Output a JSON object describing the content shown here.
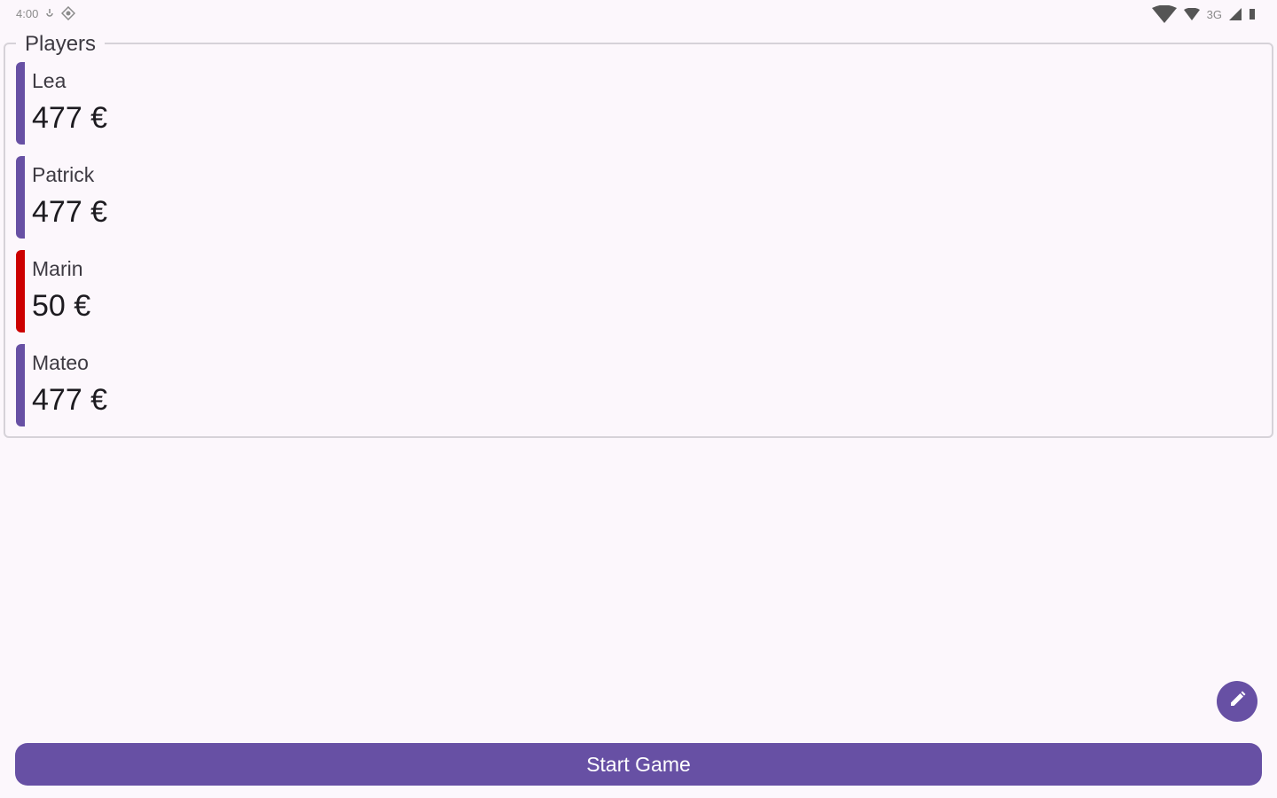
{
  "status_bar": {
    "time": "4:00",
    "network_label": "3G",
    "icons": [
      "settings-icon",
      "gear-icon",
      "wifi-icon",
      "signal-icon",
      "battery-icon"
    ]
  },
  "players_section": {
    "title": "Players",
    "players": [
      {
        "name": "Lea",
        "balance": "477 €",
        "accent_color": "#6750a4"
      },
      {
        "name": "Patrick",
        "balance": "477 €",
        "accent_color": "#6750a4"
      },
      {
        "name": "Marin",
        "balance": "50 €",
        "accent_color": "#cc0000"
      },
      {
        "name": "Mateo",
        "balance": "477 €",
        "accent_color": "#6750a4"
      }
    ]
  },
  "fab": {
    "icon": "pencil-icon"
  },
  "actions": {
    "start_label": "Start Game"
  },
  "colors": {
    "primary": "#6750a4",
    "warning": "#cc0000",
    "background": "#fcf7fc"
  }
}
